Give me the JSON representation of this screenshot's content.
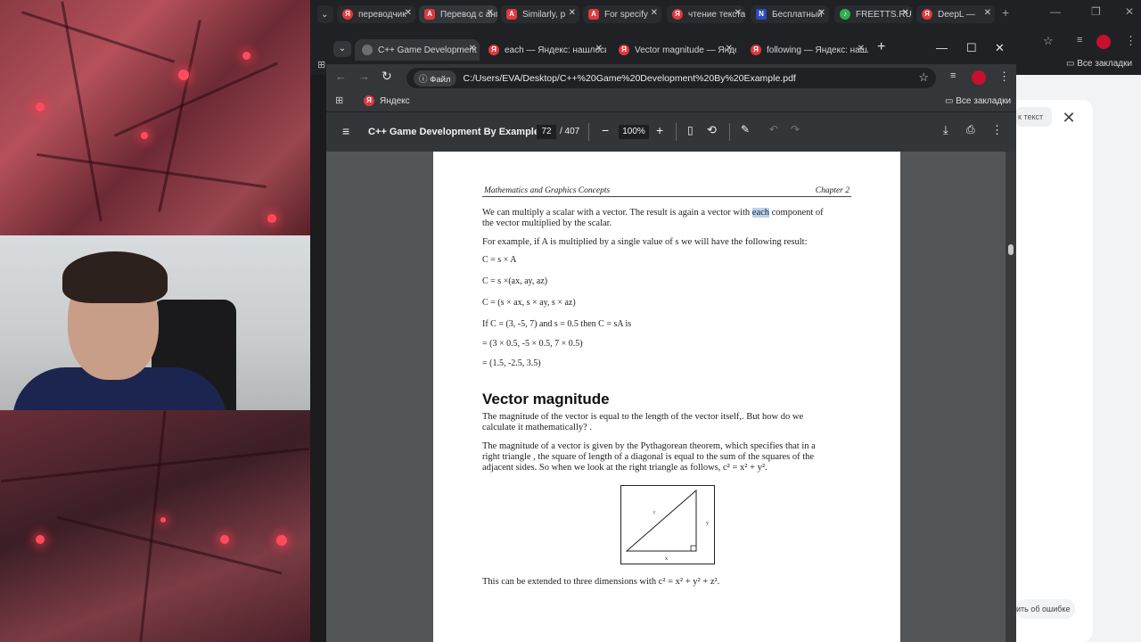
{
  "outer_tabs": [
    {
      "label": "переводчик",
      "icon": "yandex-icon"
    },
    {
      "label": "Перевод с английского",
      "icon": "translate-icon"
    },
    {
      "label": "Similarly, p",
      "icon": "translate-icon"
    },
    {
      "label": "For specify",
      "icon": "translate-icon"
    },
    {
      "label": "чтение текста",
      "icon": "yandex-icon"
    },
    {
      "label": "Бесплатный",
      "icon": "n-icon"
    },
    {
      "label": "FREETTS.RU",
      "icon": "audio-icon"
    },
    {
      "label": "DeepL —",
      "icon": "yandex-icon"
    }
  ],
  "outer_bookmarks": {
    "all_bookmarks": "Все закладки"
  },
  "deepl_panel": {
    "chip": "к текст",
    "report": "ить об ошибке"
  },
  "inner_tabs": [
    {
      "label": "C++ Game Development",
      "icon": "globe-icon"
    },
    {
      "label": "each — Яндекс: нашлось",
      "icon": "yandex-icon"
    },
    {
      "label": "Vector magnitude — Яндекс",
      "icon": "yandex-icon"
    },
    {
      "label": "following — Яндекс: нашлось",
      "icon": "yandex-icon"
    }
  ],
  "address": {
    "chip": "Файл",
    "url": "C:/Users/EVA/Desktop/C++%20Game%20Development%20By%20Example.pdf"
  },
  "bookmarks": {
    "yandex": "Яндекс",
    "all_bookmarks": "Все закладки"
  },
  "pdf_toolbar": {
    "title": "C++ Game Development By Example",
    "page_current": "72",
    "page_total": "/ 407",
    "zoom": "100%"
  },
  "page": {
    "header_left": "Mathematics and Graphics Concepts",
    "header_right": "Chapter 2",
    "p1_line1_pre": "We can multiply a scalar with a vector. The result is again a vector with ",
    "p1_highlight": "each",
    "p1_line1_post": " component of",
    "p1_line2": "the vector multiplied by the scalar.",
    "p2": "For example, if A is multiplied by a single value of s we will have the following result:",
    "eq1": "C = s × A",
    "eq2": "C = s ×(ax, ay, az)",
    "eq3": "C = (s × ax, s × ay, s × az)",
    "eq4": "If C = (3, -5, 7) and s = 0.5 then C = sA is",
    "eq5": "= (3 × 0.5, -5 × 0.5, 7 × 0.5)",
    "eq6": "= (1.5, -2.5, 3.5)",
    "heading": "Vector magnitude",
    "p3_line1": "The magnitude of the vector is equal to the length of the vector itself,. But how do we",
    "p3_line2": "calculate it mathematically? .",
    "p4_line1": "The magnitude of a vector is given by the Pythagorean theorem, which specifies that in a",
    "p4_line2": "right triangle , the square of length of a diagonal is equal to the sum of the squares of the",
    "p4_line3": "adjacent sides. So when we look at the right triangle as follows, c² = x² + y².",
    "tri_c": "c",
    "tri_y": "y",
    "tri_x": "x",
    "p5": "This can be extended to three dimensions with c² = x² + y² + z²."
  }
}
